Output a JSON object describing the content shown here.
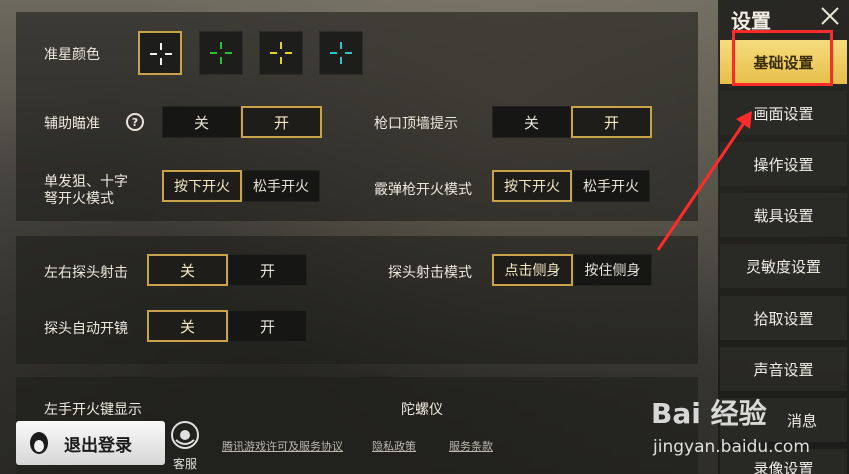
{
  "crosshair": {
    "label": "准星颜色",
    "swatches": [
      {
        "icon": "white-crosshair-icon",
        "color": "#f2f2f2",
        "selected": true
      },
      {
        "icon": "green-crosshair-icon",
        "color": "#27c22f",
        "selected": false
      },
      {
        "icon": "yellow-crosshair-icon",
        "color": "#e3d52b",
        "selected": false
      },
      {
        "icon": "cyan-crosshair-icon",
        "color": "#25c9c9",
        "selected": false
      }
    ]
  },
  "settings": {
    "aim_assist": {
      "label": "辅助瞄准",
      "help": "?",
      "options": [
        "关",
        "开"
      ],
      "selected": "开"
    },
    "muzzle_wall": {
      "label": "枪口顶墙提示",
      "options": [
        "关",
        "开"
      ],
      "selected": "开"
    },
    "sniper_fire": {
      "label_line1": "单发狙、十字",
      "label_line2": "弩开火模式",
      "options": [
        "按下开火",
        "松手开火"
      ],
      "selected": "按下开火"
    },
    "shotgun_fire": {
      "label": "霰弹枪开火模式",
      "options": [
        "按下开火",
        "松手开火"
      ],
      "selected": "按下开火"
    },
    "peek_shoot": {
      "label": "左右探头射击",
      "options": [
        "关",
        "开"
      ],
      "selected": "关"
    },
    "peek_mode": {
      "label": "探头射击模式",
      "options": [
        "点击侧身",
        "按住侧身"
      ],
      "selected": "点击侧身"
    },
    "peek_scope": {
      "label": "探头自动开镜",
      "options": [
        "关",
        "开"
      ],
      "selected": "关"
    },
    "left_fire": {
      "label": "左手开火键显示"
    },
    "gyro": {
      "label": "陀螺仪"
    }
  },
  "sidebar": {
    "title": "设置",
    "items": [
      "基础设置",
      "画面设置",
      "操作设置",
      "载具设置",
      "灵敏度设置",
      "拾取设置",
      "声音设置",
      "消息",
      "录像设置"
    ],
    "active": "基础设置"
  },
  "footer": {
    "logout": "退出登录",
    "service": "客服",
    "links": [
      "腾讯游戏许可及服务协议",
      "隐私政策",
      "服务条款"
    ]
  },
  "watermark": {
    "brand": "Bai 经验",
    "url": "jingyan.baidu.com"
  },
  "colors": {
    "accent": "#c9a349",
    "active_tab": "#e7bf4a",
    "annotation": "#ff2a2a"
  }
}
